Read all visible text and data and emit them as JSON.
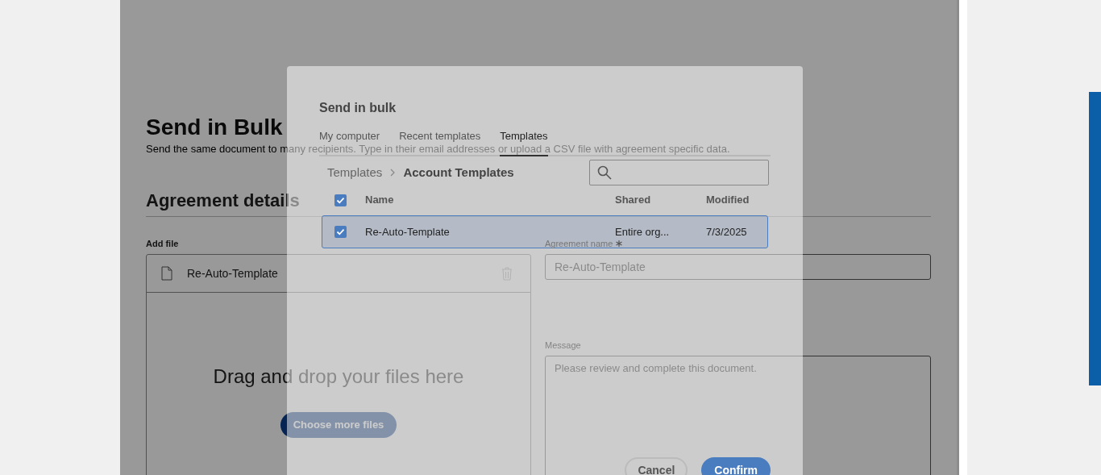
{
  "page": {
    "title": "Send in Bulk",
    "subtitle": "Send the same document to many recipients. Type in their email addresses or upload a CSV file with agreement specific data.",
    "section_title": "Agreement details",
    "add_file_label": "Add file",
    "file": {
      "name": "Re-Auto-Template"
    },
    "dropzone_text": "Drag and drop your files here",
    "choose_button": "Choose more files",
    "agreement_name": {
      "label": "Agreement name",
      "required": true,
      "value": "Re-Auto-Template"
    },
    "message": {
      "label": "Message",
      "value": "Please review and complete this document."
    }
  },
  "dialog": {
    "title": "Send in bulk",
    "tabs": [
      {
        "label": "My computer",
        "selected": false
      },
      {
        "label": "Recent templates",
        "selected": false
      },
      {
        "label": "Templates",
        "selected": true
      }
    ],
    "breadcrumb": [
      "Templates",
      "Account Templates"
    ],
    "table": {
      "select_all_checked": true,
      "columns": [
        "Name",
        "Shared",
        "Modified"
      ],
      "rows": [
        {
          "checked": true,
          "selected": true,
          "cells": [
            "Re-Auto-Template",
            "Entire org...",
            "7/3/2025"
          ]
        }
      ]
    },
    "buttons": [
      {
        "label": "Cancel",
        "kind": "secondary"
      },
      {
        "label": "Confirm",
        "kind": "primary"
      }
    ]
  }
}
